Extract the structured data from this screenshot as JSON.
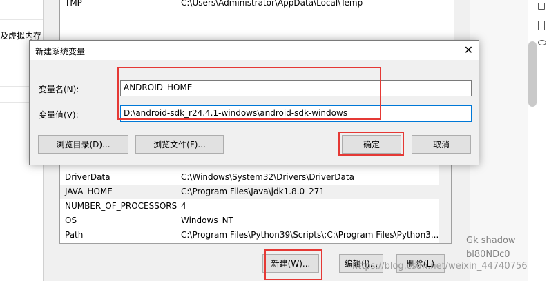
{
  "left_pane": {
    "text": "及虚拟内存"
  },
  "user_vars": {
    "name": "TMP",
    "value": "C:\\Users\\Administrator\\AppData\\Local\\Temp"
  },
  "system_vars": [
    {
      "name": "DriverData",
      "value": "C:\\Windows\\System32\\Drivers\\DriverData"
    },
    {
      "name": "JAVA_HOME",
      "value": "C:\\Program Files\\Java\\jdk1.8.0_271"
    },
    {
      "name": "NUMBER_OF_PROCESSORS",
      "value": "4"
    },
    {
      "name": "OS",
      "value": "Windows_NT"
    },
    {
      "name": "Path",
      "value": "C:\\Program Files\\Python39\\Scripts\\;C:\\Program Files\\Python3..."
    }
  ],
  "bottom_buttons": {
    "new": "新建(W)...",
    "edit": "编辑(I)...",
    "delete": "删除(L)"
  },
  "dialog": {
    "title": "新建系统变量",
    "close": "✕",
    "name_label": "变量名(N):",
    "name_value": "ANDROID_HOME",
    "value_label": "变量值(V):",
    "value_value": "D:\\android-sdk_r24.4.1-windows\\android-sdk-windows",
    "browse_dir": "浏览目录(D)...",
    "browse_file": "浏览文件(F)...",
    "ok": "确定",
    "cancel": "取消"
  },
  "right_pane": {
    "line1": "Gk shadow",
    "line2": "bl80NDc0"
  },
  "watermark": "https://blog.csdn.net/weixin_44740756",
  "colors": {
    "highlight": "#e53935",
    "focus": "#0078d7"
  }
}
